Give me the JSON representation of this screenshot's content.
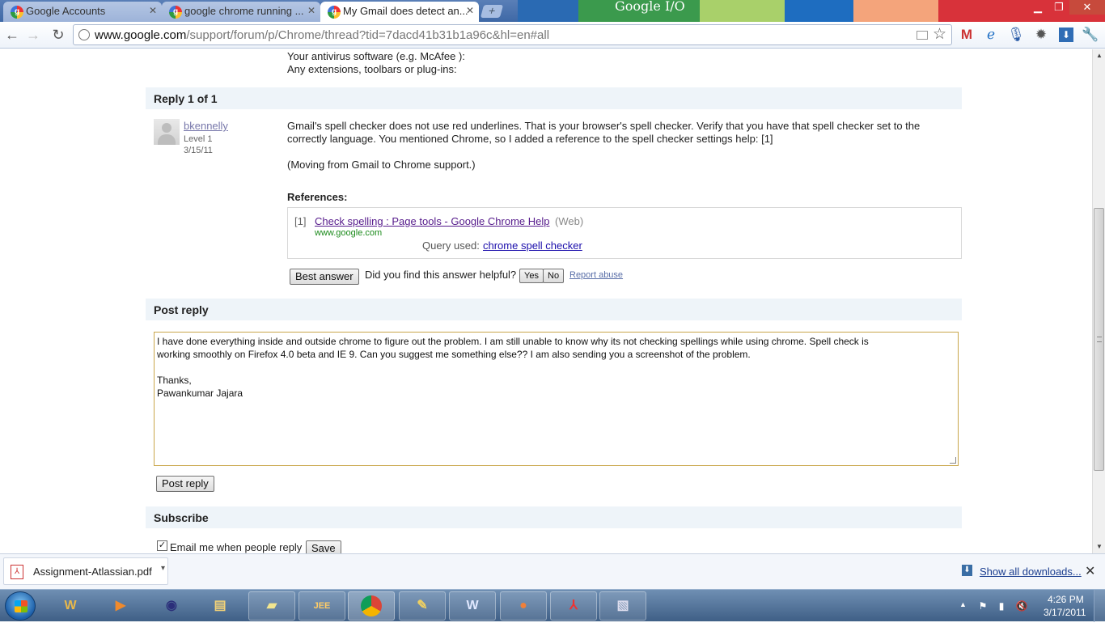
{
  "browser": {
    "tabs": [
      {
        "label": "Google Accounts",
        "active": false
      },
      {
        "label": "google chrome running ...",
        "active": false
      },
      {
        "label": "My Gmail does detect an...",
        "active": true
      }
    ],
    "promo_text": "Google",
    "url_host": "www.google.com",
    "url_path": "/support/forum/p/Chrome/thread?tid=7dacd41b31b1a96c&hl=en#all"
  },
  "page": {
    "top_lines": [
      "Your antivirus software (e.g. McAfee ):",
      "Any extensions, toolbars or plug-ins:"
    ],
    "reply_header": "Reply 1 of 1",
    "author": {
      "name": "bkennelly",
      "level": "Level 1",
      "date": "3/15/11"
    },
    "reply_body_1": "Gmail's spell checker does not use red underlines.  That is your browser's spell checker.  Verify that you have that spell checker set to the",
    "reply_body_2": "correctly language.  You mentioned Chrome, so I added a reference to the spell checker settings help: [1]",
    "reply_body_3": "(Moving from Gmail to Chrome support.)",
    "references_label": "References:",
    "reference": {
      "index": "[1]",
      "title": "Check spelling : Page tools - Google Chrome Help",
      "type": "(Web)",
      "url": "www.google.com",
      "query_label": "Query used:",
      "query": "chrome spell checker"
    },
    "best_answer_label": "Best answer",
    "helpful_question": "Did you find this answer helpful?",
    "yes_label": "Yes",
    "no_label": "No",
    "report_abuse": "Report abuse",
    "post_reply_header": "Post reply",
    "reply_text": "I have done everything inside and outside chrome to figure out the problem. I am still unable to know why its not checking spellings while using chrome. Spell check is\nworking smoothly on Firefox 4.0 beta and IE 9. Can you suggest me something else?? I am also sending you a screenshot of the problem.\n\nThanks,\nPawankumar Jajara",
    "post_reply_button": "Post reply",
    "subscribe_header": "Subscribe",
    "email_me_label": "Email me when people reply",
    "save_label": "Save"
  },
  "downloads": {
    "file_name": "Assignment-Atlassian.pdf",
    "show_all": "Show all downloads..."
  },
  "taskbar": {
    "time": "4:26 PM",
    "date": "3/17/2011"
  }
}
